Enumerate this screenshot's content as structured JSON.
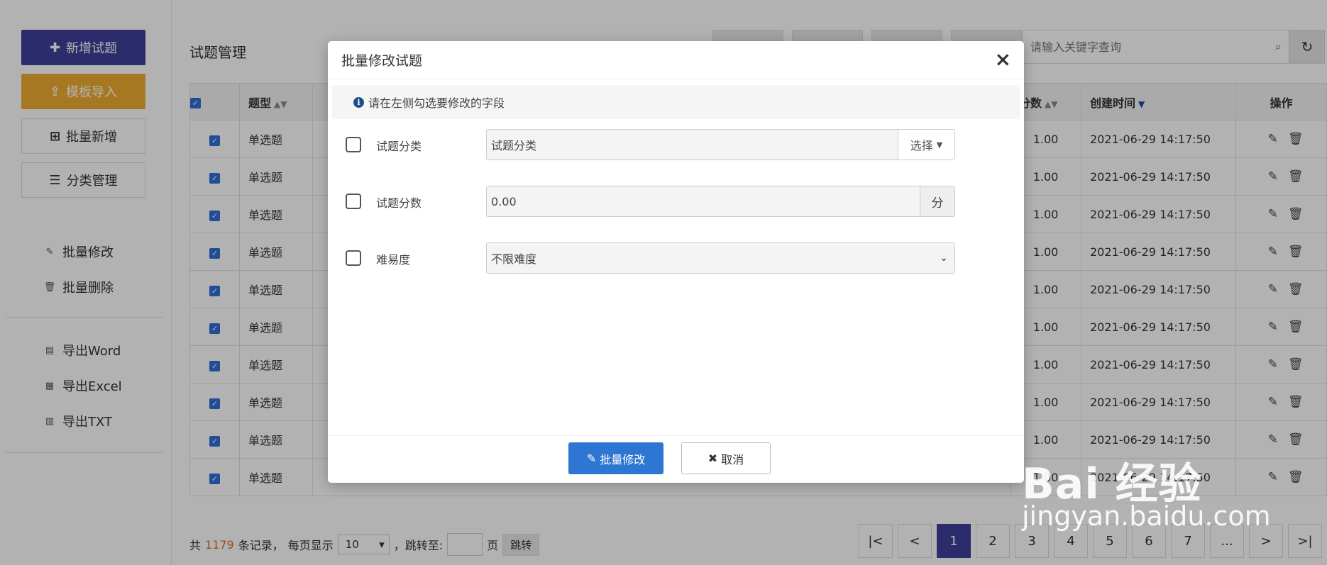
{
  "sidebar": {
    "add_label": "新增试题",
    "import_label": "模板导入",
    "batch_add_label": "批量新增",
    "category_label": "分类管理",
    "batch_edit_label": "批量修改",
    "batch_delete_label": "批量删除",
    "export_word_label": "导出Word",
    "export_excel_label": "导出Excel",
    "export_txt_label": "导出TXT"
  },
  "page": {
    "title": "试题管理",
    "search_placeholder": "请输入关键字查询"
  },
  "table": {
    "headers": {
      "type": "题型",
      "score": "分数",
      "created": "创建时间",
      "ops": "操作"
    },
    "rows": [
      {
        "type": "单选题",
        "score": "1.00",
        "created": "2021-06-29 14:17:50"
      },
      {
        "type": "单选题",
        "score": "1.00",
        "created": "2021-06-29 14:17:50"
      },
      {
        "type": "单选题",
        "score": "1.00",
        "created": "2021-06-29 14:17:50"
      },
      {
        "type": "单选题",
        "score": "1.00",
        "created": "2021-06-29 14:17:50"
      },
      {
        "type": "单选题",
        "score": "1.00",
        "created": "2021-06-29 14:17:50"
      },
      {
        "type": "单选题",
        "score": "1.00",
        "created": "2021-06-29 14:17:50"
      },
      {
        "type": "单选题",
        "score": "1.00",
        "created": "2021-06-29 14:17:50"
      },
      {
        "type": "单选题",
        "score": "1.00",
        "created": "2021-06-29 14:17:50"
      },
      {
        "type": "单选题",
        "score": "1.00",
        "created": "2021-06-29 14:17:50"
      },
      {
        "type": "单选题",
        "score": "1.00",
        "created": "2021-06-29 14:17:50"
      }
    ]
  },
  "footer": {
    "prefix": "共",
    "total": "1179",
    "suffix": "条记录，",
    "per_page_label": "每页显示",
    "per_page_value": "10",
    "jump_label": "，跳转至:",
    "page_unit": "页",
    "jump_button": "跳转"
  },
  "pagination": {
    "first": "|<",
    "prev": "<",
    "pages": [
      "1",
      "2",
      "3",
      "4",
      "5",
      "6",
      "7"
    ],
    "current": "1",
    "ellipsis": "...",
    "next": ">",
    "last": ">|"
  },
  "modal": {
    "title": "批量修改试题",
    "close": "×",
    "tip": "请在左侧勾选要修改的字段",
    "fields": {
      "category": {
        "label": "试题分类",
        "value": "试题分类",
        "addon": "选择"
      },
      "score": {
        "label": "试题分数",
        "value": "0.00",
        "addon": "分"
      },
      "difficulty": {
        "label": "难易度",
        "value": "不限难度"
      }
    },
    "ok_label": "批量修改",
    "cancel_label": "取消"
  },
  "watermark": {
    "logo": "Bai 经验",
    "site": "jingyan.baidu.com"
  },
  "colors": {
    "primary": "#3f3f9c",
    "warning": "#f0ad31",
    "accent_blue": "#2d76d2",
    "count_orange": "#e36d1d"
  }
}
